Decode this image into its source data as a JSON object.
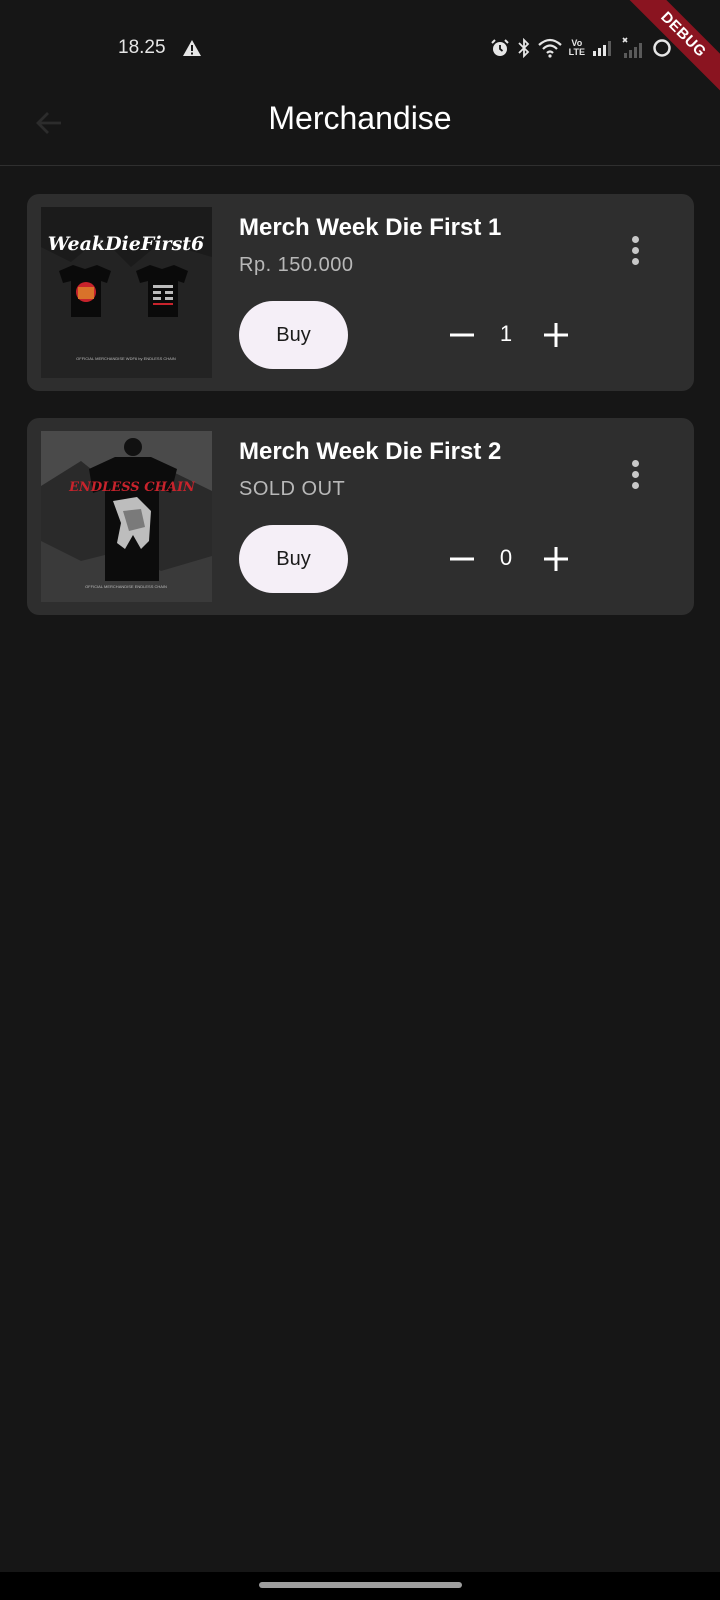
{
  "status_bar": {
    "time": "18.25",
    "icons": [
      "warning-icon",
      "alarm-icon",
      "bluetooth-icon",
      "wifi-icon",
      "volte-icon",
      "signal-icon",
      "signal-no-service-icon",
      "battery-icon"
    ],
    "volte_top": "Vo",
    "volte_bottom": "LTE"
  },
  "debug_banner": {
    "label": "DEBUG",
    "color": "#8a1420"
  },
  "app_bar": {
    "title": "Merchandise",
    "back_icon": "arrow-back-icon"
  },
  "merch": {
    "items": [
      {
        "name": "Merch Week Die First 1",
        "price": "Rp. 150.000",
        "buy_label": "Buy",
        "quantity": "1",
        "image_title": "WeakDieFirst6",
        "image_caption": "OFFICIAL MERCHANDISE WDF6 by ENDLESS CHAIN"
      },
      {
        "name": "Merch Week Die First 2",
        "price": "SOLD OUT",
        "buy_label": "Buy",
        "quantity": "0",
        "image_title": "ENDLESS CHAIN",
        "image_caption": "OFFICIAL MERCHANDISE ENDLESS CHAIN"
      }
    ]
  },
  "colors": {
    "background": "#161616",
    "card": "#2e2e2e",
    "button": "#f5eff7",
    "accent_red": "#c8232c"
  }
}
